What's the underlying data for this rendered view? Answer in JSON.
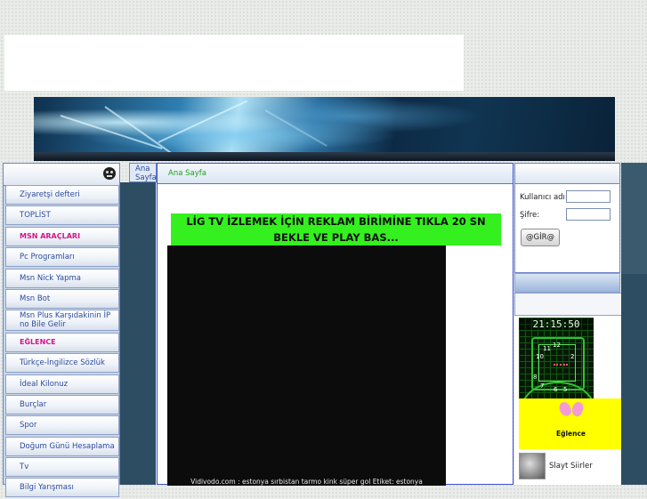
{
  "menu": {
    "items": [
      {
        "label": "Ziyaretşi defteri",
        "style": "normal"
      },
      {
        "label": "TOPLİST",
        "style": "normal"
      },
      {
        "label": "MSN ARAÇLARI",
        "style": "pink"
      },
      {
        "label": "Pc Programları",
        "style": "normal"
      },
      {
        "label": "Msn Nick Yapma",
        "style": "normal"
      },
      {
        "label": "Msn Bot",
        "style": "normal"
      },
      {
        "label": "Msn Plus Karşıdakinin İP no Bile Gelir",
        "style": "tall"
      },
      {
        "label": "EĞLENCE",
        "style": "pink"
      },
      {
        "label": "Türkçe-İngilizce Sözlük",
        "style": "normal"
      },
      {
        "label": "İdeal Kilonuz",
        "style": "normal"
      },
      {
        "label": "Burçlar",
        "style": "normal"
      },
      {
        "label": "Spor",
        "style": "normal"
      },
      {
        "label": "Doğum Günü Hesaplama",
        "style": "normal"
      },
      {
        "label": "Tv",
        "style": "normal"
      },
      {
        "label": "Bilgi Yarışması",
        "style": "normal"
      }
    ]
  },
  "breadcrumb": {
    "label": "Ana Sayfa"
  },
  "main": {
    "header": "Ana Sayfa",
    "announcement": "LİG TV İZLEMEK İÇİN REKLAM BİRİMİNE TIKLA 20 SN BEKLE VE PLAY BAS...",
    "video_caption": "Vidivodo.com : estonya sırbistan tarmo kink süper gol  Etiket: estonya"
  },
  "login": {
    "username_label": "Kullanıcı adı:",
    "password_label": "Şifre:",
    "submit_label": "@GİR@"
  },
  "widgets": {
    "clock_time": "21:15:50",
    "eglence_label": "Eğlence",
    "slayt_label": "Slayt Siirler"
  },
  "colors": {
    "announcement_bg": "#35f01f",
    "menu_text": "#2b4aa0",
    "menu_pink": "#d5138d",
    "crumb_green": "#1fa01f"
  }
}
